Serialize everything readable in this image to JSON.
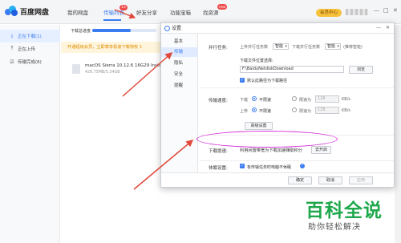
{
  "app": {
    "logo_text": "百度网盘",
    "nav": [
      "我的网盘",
      "传输列表",
      "好友分享",
      "功能宝箱",
      "找资源"
    ],
    "nav_badge_count": "13",
    "nav_badge_new": "new",
    "vip_button": "会员中心",
    "colors": {
      "accent": "#3a7cf2",
      "promo_text": "#e08a00",
      "annotation_ellipse": "#d42cd6",
      "annotation_arrow": "#e0483b"
    }
  },
  "sidebar": {
    "items": [
      {
        "icon": "download-icon",
        "label": "正在下载(1)"
      },
      {
        "icon": "upload-icon",
        "label": "正在上传"
      },
      {
        "icon": "check-icon",
        "label": "传输完成(6)"
      }
    ]
  },
  "transfer": {
    "header_label": "下载总进度",
    "progress_fraction": 0.6,
    "promo_text": "开通超级会员，立即尊享极速下载特权 1",
    "file": {
      "name": "macOS Sierra 10.12.6 16G29 Install",
      "size": "426.75MB/5.34GB"
    }
  },
  "dialog": {
    "title": "设置",
    "nav": [
      "基本",
      "传输",
      "隐私",
      "安全",
      "提醒"
    ],
    "parallel": {
      "label": "并行任务:",
      "upload_label": "上传并行任务数",
      "upload_value": "智能",
      "download_label": "下载并行任务数",
      "download_value": "智能",
      "hint": "(推荐智能)"
    },
    "location": {
      "label": "下载文件位置选择:",
      "path": "F:\\BaiduNetdiskDownload",
      "browse": "浏览",
      "default_label": "默认此路径为下载路径"
    },
    "speed": {
      "label": "传输速度:",
      "download": "下载",
      "upload": "上传",
      "unlimited": "不限速",
      "limited": "限速为",
      "download_limit": "128",
      "upload_limit": "128",
      "unit": "KB/s",
      "advanced": "高级设置"
    },
    "accel": {
      "label": "下载提速:",
      "text": "利用闲置带宽为下载加速赚取积分",
      "button": "去开启"
    },
    "sleep": {
      "label": "休眠设置:",
      "text": "有传输任务时电脑不休眠"
    },
    "footer": {
      "ok": "确定",
      "cancel": "取消",
      "apply": "应用"
    }
  },
  "watermark": {
    "title": "百科全说",
    "subtitle": "助你轻松解决"
  }
}
